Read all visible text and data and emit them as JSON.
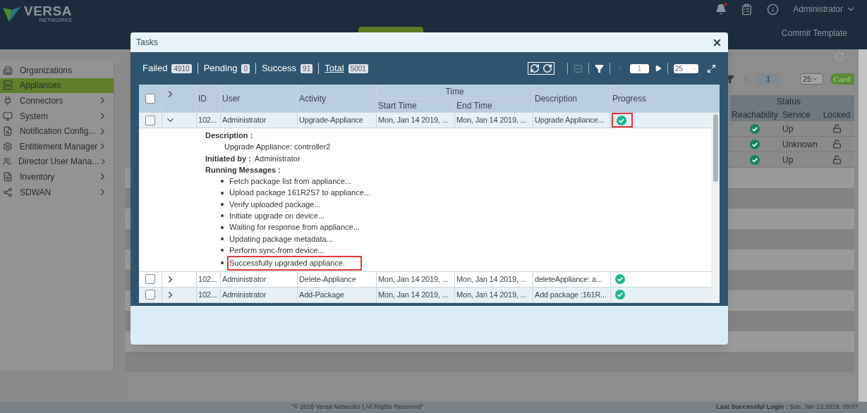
{
  "header": {
    "logo": {
      "name": "VERSA",
      "tagline": "NETWORKS"
    },
    "user_menu": "Administrator",
    "notification_alert": true,
    "commit_button": "Commit Template"
  },
  "sidebar": {
    "items": [
      {
        "label": "Organizations",
        "expandable": false,
        "selected": false
      },
      {
        "label": "Appliances",
        "expandable": false,
        "selected": true
      },
      {
        "label": "Connectors",
        "expandable": true,
        "selected": false
      },
      {
        "label": "System",
        "expandable": true,
        "selected": false
      },
      {
        "label": "Notification Config...",
        "expandable": true,
        "selected": false
      },
      {
        "label": "Entitlement Manager",
        "expandable": true,
        "selected": false
      },
      {
        "label": "Director User Mana...",
        "expandable": true,
        "selected": false
      },
      {
        "label": "Inventory",
        "expandable": true,
        "selected": false
      },
      {
        "label": "SDWAN",
        "expandable": true,
        "selected": false
      }
    ]
  },
  "appliances": {
    "pager": {
      "page": "1",
      "per_page": "25"
    },
    "card_button": "Card",
    "status_group": "Status",
    "columns": [
      "Reachability",
      "Service",
      "Locked"
    ],
    "rows": [
      {
        "reachable": true,
        "service": "Up",
        "locked": false
      },
      {
        "reachable": true,
        "service": "Unknown",
        "locked": false
      },
      {
        "reachable": true,
        "service": "Up",
        "locked": false
      }
    ]
  },
  "tasks_dialog": {
    "title": "Tasks",
    "summary": [
      {
        "label": "Failed",
        "count": "4910",
        "kind": "text"
      },
      {
        "label": "Pending",
        "count": "0",
        "kind": "text"
      },
      {
        "label": "Success",
        "count": "91",
        "kind": "text"
      },
      {
        "label": "Total",
        "count": "5001",
        "kind": "link"
      }
    ],
    "pager": {
      "page": "1",
      "per_page": "25"
    },
    "columns": {
      "id": "ID",
      "user": "User",
      "activity": "Activity",
      "time_group": "Time",
      "start": "Start Time",
      "end": "End Time",
      "description": "Description",
      "progress": "Progress"
    },
    "header_checked": false,
    "rows": [
      {
        "checked": false,
        "expanded": true,
        "id": "102...",
        "user": "Administrator",
        "activity": "Upgrade-Appliance",
        "start": "Mon, Jan 14 2019, ...",
        "end": "Mon, Jan 14 2019, ...",
        "description": "Upgrade Appliance...",
        "success": true,
        "highlighted": true,
        "details": {
          "description_label": "Description :",
          "description": "Upgrade Appliance: controller2",
          "initiated_label": "Initiated by :",
          "initiated_by": "Administrator",
          "messages_label": "Running Messages :",
          "messages": [
            {
              "text": "Fetch package list from appliance...",
              "highlighted": false
            },
            {
              "text": "Upload package 161R2S7 to appliance...",
              "highlighted": false
            },
            {
              "text": "Verify uploaded package...",
              "highlighted": false
            },
            {
              "text": "Initiate upgrade on device...",
              "highlighted": false
            },
            {
              "text": "Waiting for response from appliance...",
              "highlighted": false
            },
            {
              "text": "Updating package metadata...",
              "highlighted": false
            },
            {
              "text": "Perform sync-from device...",
              "highlighted": false
            },
            {
              "text": "Successfully upgraded appliance.",
              "highlighted": true
            }
          ]
        }
      },
      {
        "checked": false,
        "expanded": false,
        "id": "102...",
        "user": "Administrator",
        "activity": "Delete-Appliance",
        "start": "Mon, Jan 14 2019, ...",
        "end": "Mon, Jan 14 2019, ...",
        "description": "deleteAppliance: a...",
        "success": true,
        "highlighted": false
      },
      {
        "checked": false,
        "expanded": false,
        "id": "102...",
        "user": "Administrator",
        "activity": "Add-Package",
        "start": "Mon, Jan 14 2019, ...",
        "end": "Mon, Jan 14 2019, ...",
        "description": "Add package :161R...",
        "success": true,
        "highlighted": false
      }
    ]
  },
  "footer": {
    "copyright": "\"© 2018 Versa Networks | All Rights Reserved\"",
    "last_login_label": "Last Successful Login :",
    "last_login": "Sun, Jan 13 2019, 09:07"
  }
}
